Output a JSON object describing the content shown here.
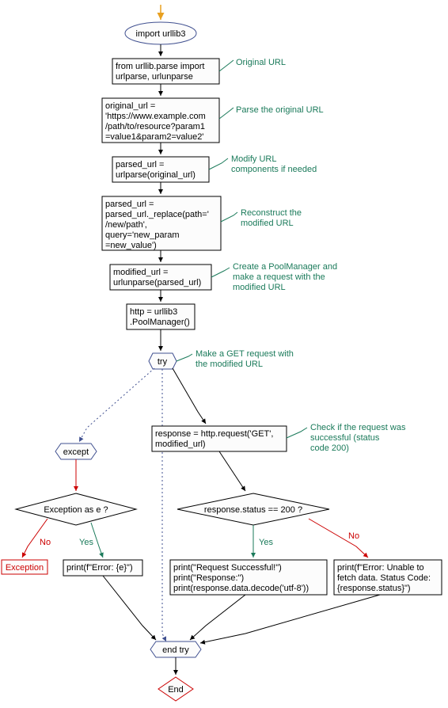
{
  "chart_data": {
    "type": "flowchart",
    "nodes": [
      {
        "id": "n1",
        "label": "import urllib3",
        "shape": "ellipse"
      },
      {
        "id": "n2",
        "label": "from urllib.parse import urlparse, urlunparse",
        "shape": "rect",
        "comment": "Original URL"
      },
      {
        "id": "n3",
        "label": "original_url = 'https://www.example.com/path/to/resource?param1=value1&param2=value2'",
        "shape": "rect",
        "comment": "Parse the original URL"
      },
      {
        "id": "n4",
        "label": "parsed_url = urlparse(original_url)",
        "shape": "rect",
        "comment": "Modify URL components if needed"
      },
      {
        "id": "n5",
        "label": "parsed_url = parsed_url._replace(path='/new/path', query='new_param=new_value')",
        "shape": "rect",
        "comment": "Reconstruct the modified URL"
      },
      {
        "id": "n6",
        "label": "modified_url = urlunparse(parsed_url)",
        "shape": "rect",
        "comment": "Create a PoolManager and make a request with the modified URL"
      },
      {
        "id": "n7",
        "label": "http = urllib3.PoolManager()",
        "shape": "rect"
      },
      {
        "id": "n8",
        "label": "try",
        "shape": "hexagon",
        "comment": "Make a GET request with the modified URL"
      },
      {
        "id": "n9",
        "label": "except",
        "shape": "hexagon"
      },
      {
        "id": "n10",
        "label": "response = http.request('GET', modified_url)",
        "shape": "rect",
        "comment": "Check if the request was successful (status code 200)"
      },
      {
        "id": "n11",
        "label": "Exception as e ?",
        "shape": "diamond"
      },
      {
        "id": "n12",
        "label": "response.status == 200 ?",
        "shape": "diamond"
      },
      {
        "id": "n13",
        "label": "Exception",
        "shape": "text-red"
      },
      {
        "id": "n14",
        "label": "print(f\"Error: {e}\")",
        "shape": "rect"
      },
      {
        "id": "n15",
        "label": "print(\"Request Successful!\")\nprint(\"Response:\")\nprint(response.data.decode('utf-8'))",
        "shape": "rect"
      },
      {
        "id": "n16",
        "label": "print(f\"Error: Unable to fetch data. Status Code: {response.status}\")",
        "shape": "rect"
      },
      {
        "id": "n17",
        "label": "end try",
        "shape": "hexagon"
      },
      {
        "id": "n18",
        "label": "End",
        "shape": "diamond-small"
      }
    ],
    "edges": [
      {
        "from": "start",
        "to": "n1"
      },
      {
        "from": "n1",
        "to": "n2"
      },
      {
        "from": "n2",
        "to": "n3"
      },
      {
        "from": "n3",
        "to": "n4"
      },
      {
        "from": "n4",
        "to": "n5"
      },
      {
        "from": "n5",
        "to": "n6"
      },
      {
        "from": "n6",
        "to": "n7"
      },
      {
        "from": "n7",
        "to": "n8"
      },
      {
        "from": "n8",
        "to": "n9",
        "style": "dotted"
      },
      {
        "from": "n8",
        "to": "n10"
      },
      {
        "from": "n9",
        "to": "n11"
      },
      {
        "from": "n10",
        "to": "n12"
      },
      {
        "from": "n11",
        "to": "n13",
        "label": "No",
        "color": "red"
      },
      {
        "from": "n11",
        "to": "n14",
        "label": "Yes",
        "color": "green"
      },
      {
        "from": "n12",
        "to": "n15",
        "label": "Yes",
        "color": "green"
      },
      {
        "from": "n12",
        "to": "n16",
        "label": "No",
        "color": "red"
      },
      {
        "from": "n14",
        "to": "n17"
      },
      {
        "from": "n15",
        "to": "n17"
      },
      {
        "from": "n16",
        "to": "n17"
      },
      {
        "from": "n8",
        "to": "n17",
        "style": "dotted"
      },
      {
        "from": "n17",
        "to": "n18"
      }
    ]
  },
  "labels": {
    "n1": "import urllib3",
    "n2l1": "from urllib.parse import",
    "n2l2": "urlparse, urlunparse",
    "c2": "Original URL",
    "n3l1": "original_url =",
    "n3l2": "'https://www.example.com",
    "n3l3": "/path/to/resource?param1",
    "n3l4": "=value1&param2=value2'",
    "c3": "Parse the original URL",
    "n4l1": "parsed_url =",
    "n4l2": "urlparse(original_url)",
    "c4l1": "Modify URL",
    "c4l2": "components if needed",
    "n5l1": "parsed_url =",
    "n5l2": "parsed_url._replace(path='",
    "n5l3": "/new/path',",
    "n5l4": "query='new_param",
    "n5l5": "=new_value')",
    "c5l1": "Reconstruct the",
    "c5l2": "modified URL",
    "n6l1": "modified_url =",
    "n6l2": "urlunparse(parsed_url)",
    "c6l1": "Create a PoolManager and",
    "c6l2": "make a request with the",
    "c6l3": "modified URL",
    "n7l1": "http = urllib3",
    "n7l2": ".PoolManager()",
    "n8": "try",
    "c8l1": "Make a GET request with",
    "c8l2": "the modified URL",
    "n9": "except",
    "n10l1": "response = http.request('GET',",
    "n10l2": "modified_url)",
    "c10l1": "Check if the request was",
    "c10l2": "successful (status",
    "c10l3": "code 200)",
    "n11": "Exception as e ?",
    "n12": "response.status == 200 ?",
    "n13": "Exception",
    "n14": "print(f\"Error: {e}\")",
    "n15l1": "print(\"Request Successful!\")",
    "n15l2": "print(\"Response:\")",
    "n15l3": "print(response.data.decode('utf-8'))",
    "n16l1": "print(f\"Error: Unable to",
    "n16l2": "fetch data. Status Code:",
    "n16l3": "{response.status}\")",
    "n17": "end try",
    "n18": "End",
    "yes": "Yes",
    "no": "No"
  }
}
